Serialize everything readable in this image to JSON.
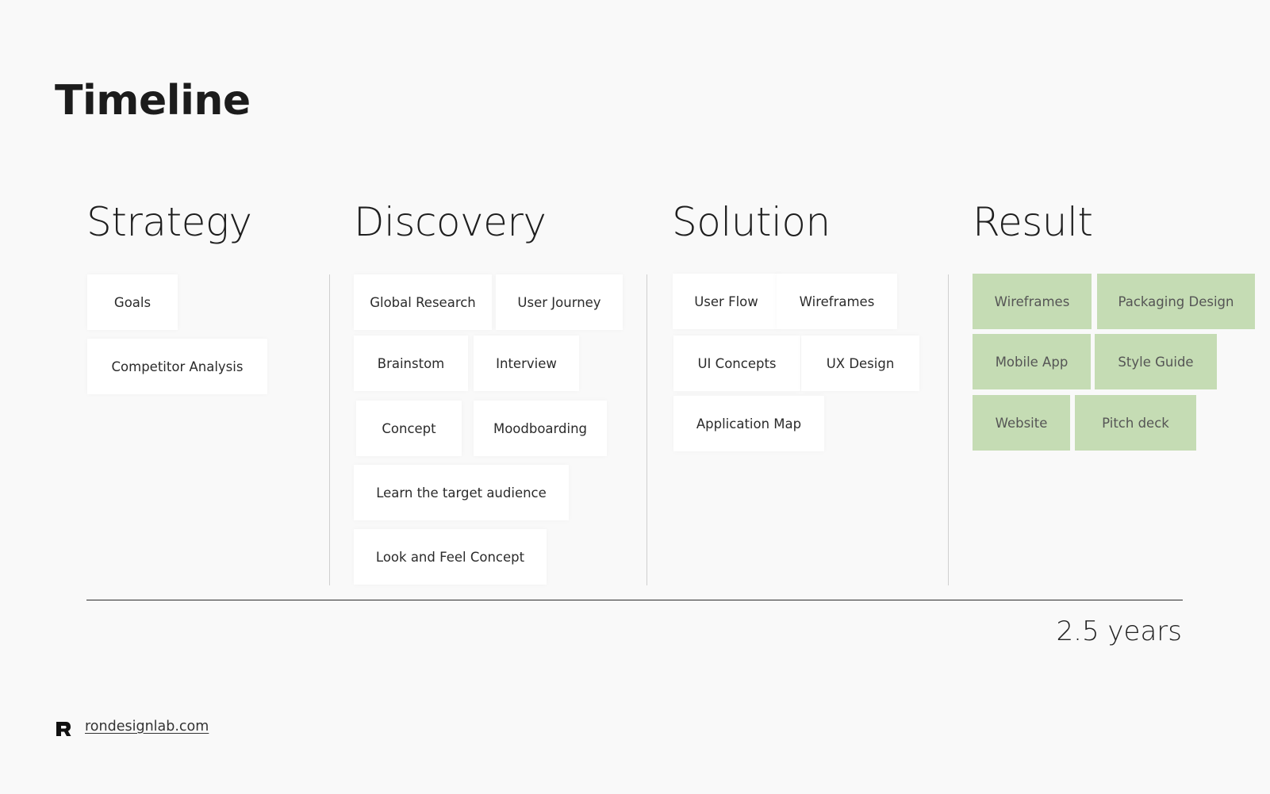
{
  "page": {
    "title": "Timeline",
    "duration": "2.5 years",
    "footer_link": "rondesignlab.com"
  },
  "colors": {
    "background": "#f9f9f9",
    "card": "#ffffff",
    "result_card": "#c5dcb4",
    "divider": "#cfcfcf",
    "timeline_line": "#2a2a2a"
  },
  "columns": [
    {
      "heading": "Strategy",
      "items": [
        "Goals",
        "Competitor Analysis"
      ]
    },
    {
      "heading": "Discovery",
      "items": [
        "Global Research",
        "User Journey",
        "Brainstom",
        "Interview",
        "Concept",
        "Moodboarding",
        "Learn the target audience",
        "Look and Feel Concept"
      ]
    },
    {
      "heading": "Solution",
      "items": [
        "User Flow",
        "Wireframes",
        "UI Concepts",
        "UX Design",
        "Application Map"
      ]
    },
    {
      "heading": "Result",
      "items": [
        "Wireframes",
        "Packaging Design",
        "Mobile App",
        "Style Guide",
        "Website",
        "Pitch deck"
      ]
    }
  ]
}
